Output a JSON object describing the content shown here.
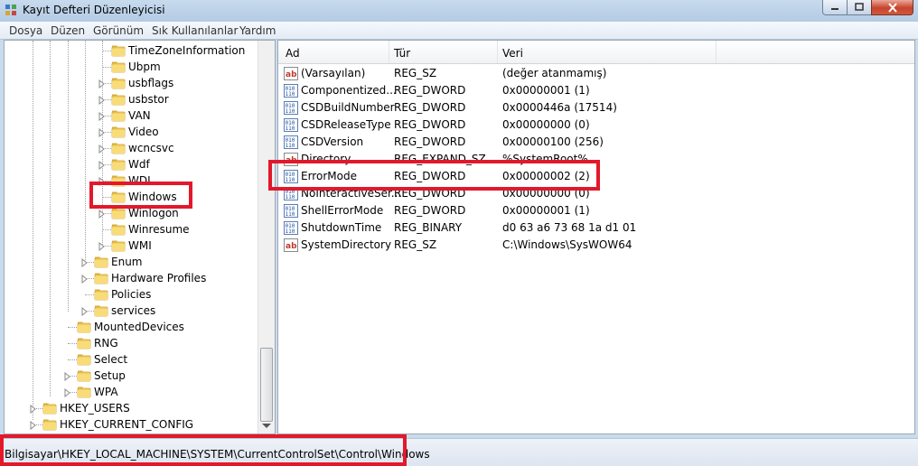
{
  "window": {
    "title": "Kayıt Defteri Düzenleyicisi"
  },
  "menu": [
    "Dosya",
    "Düzen",
    "Görünüm",
    "Sık Kullanılanlar",
    "Yardım"
  ],
  "tree": {
    "nodes": [
      {
        "label": "TimeZoneInformation",
        "expandable": false
      },
      {
        "label": "Ubpm",
        "expandable": false
      },
      {
        "label": "usbflags",
        "expandable": true
      },
      {
        "label": "usbstor",
        "expandable": true
      },
      {
        "label": "VAN",
        "expandable": true
      },
      {
        "label": "Video",
        "expandable": true
      },
      {
        "label": "wcncsvc",
        "expandable": true
      },
      {
        "label": "Wdf",
        "expandable": true
      },
      {
        "label": "WDI",
        "expandable": true
      },
      {
        "label": "Windows",
        "expandable": false,
        "selected": true
      },
      {
        "label": "Winlogon",
        "expandable": true
      },
      {
        "label": "Winresume",
        "expandable": false
      },
      {
        "label": "WMI",
        "expandable": true
      },
      {
        "label": "Enum",
        "expandable": true
      },
      {
        "label": "Hardware Profiles",
        "expandable": true
      },
      {
        "label": "Policies",
        "expandable": false
      },
      {
        "label": "services",
        "expandable": true
      },
      {
        "label": "MountedDevices",
        "expandable": false
      },
      {
        "label": "RNG",
        "expandable": false
      },
      {
        "label": "Select",
        "expandable": false
      },
      {
        "label": "Setup",
        "expandable": true
      },
      {
        "label": "WPA",
        "expandable": true
      },
      {
        "label": "HKEY_USERS",
        "expandable": true
      },
      {
        "label": "HKEY_CURRENT_CONFIG",
        "expandable": true
      }
    ]
  },
  "list": {
    "columns": [
      "Ad",
      "Tür",
      "Veri"
    ],
    "rows": [
      {
        "icon": "string-value-icon",
        "name": "(Varsayılan)",
        "type": "REG_SZ",
        "data": "(değer atanmamış)"
      },
      {
        "icon": "binary-value-icon",
        "name": "Componentized...",
        "type": "REG_DWORD",
        "data": "0x00000001 (1)"
      },
      {
        "icon": "binary-value-icon",
        "name": "CSDBuildNumber",
        "type": "REG_DWORD",
        "data": "0x0000446a (17514)"
      },
      {
        "icon": "binary-value-icon",
        "name": "CSDReleaseType",
        "type": "REG_DWORD",
        "data": "0x00000000 (0)"
      },
      {
        "icon": "binary-value-icon",
        "name": "CSDVersion",
        "type": "REG_DWORD",
        "data": "0x00000100 (256)"
      },
      {
        "icon": "string-value-icon",
        "name": "Directory",
        "type": "REG_EXPAND_SZ",
        "data": "%SystemRoot%"
      },
      {
        "icon": "binary-value-icon",
        "name": "ErrorMode",
        "type": "REG_DWORD",
        "data": "0x00000002 (2)"
      },
      {
        "icon": "binary-value-icon",
        "name": "NoInteractiveSer...",
        "type": "REG_DWORD",
        "data": "0x00000000 (0)"
      },
      {
        "icon": "binary-value-icon",
        "name": "ShellErrorMode",
        "type": "REG_DWORD",
        "data": "0x00000001 (1)"
      },
      {
        "icon": "binary-value-icon",
        "name": "ShutdownTime",
        "type": "REG_BINARY",
        "data": "d0 63 a6 73 68 1a d1 01"
      },
      {
        "icon": "string-value-icon",
        "name": "SystemDirectory",
        "type": "REG_SZ",
        "data": "C:\\Windows\\SysWOW64"
      }
    ]
  },
  "status": {
    "path": "Bilgisayar\\HKEY_LOCAL_MACHINE\\SYSTEM\\CurrentControlSet\\Control\\Windows"
  },
  "colors": {
    "highlight": "#e3182b",
    "folder": "#f3cf5c"
  }
}
